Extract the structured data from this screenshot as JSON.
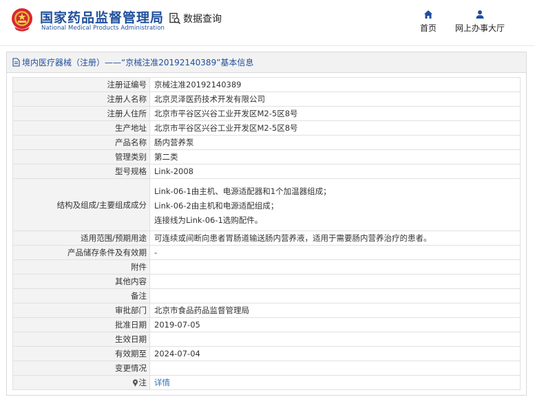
{
  "header": {
    "brand_cn": "国家药品监督管理局",
    "brand_en": "National Medical Products Administration",
    "data_query": "数据查询",
    "nav": [
      {
        "label": "首页",
        "icon": "home-icon"
      },
      {
        "label": "网上办事大厅",
        "icon": "user-icon"
      }
    ]
  },
  "panel": {
    "title": "境内医疗器械（注册）——“京械注准20192140389”基本信息",
    "title_icon": "document-icon"
  },
  "rows": [
    {
      "key": "注册证编号",
      "value": "京械注准20192140389"
    },
    {
      "key": "注册人名称",
      "value": "北京灵泽医药技术开发有限公司"
    },
    {
      "key": "注册人住所",
      "value": "北京市平谷区兴谷工业开发区M2-5区8号"
    },
    {
      "key": "生产地址",
      "value": "北京市平谷区兴谷工业开发区M2-5区8号"
    },
    {
      "key": "产品名称",
      "value": "肠内营养泵"
    },
    {
      "key": "管理类别",
      "value": "第二类"
    },
    {
      "key": "型号规格",
      "value": "Link-2008"
    }
  ],
  "structure": {
    "key": "结构及组成/主要组成成分",
    "lines": [
      "Link-06-1由主机、电源适配器和1个加温器组成；",
      "Link-06-2由主机和电源适配组成；",
      "连接线为Link-06-1选购配件。"
    ]
  },
  "rows2": [
    {
      "key": "适用范围/预期用途",
      "value": "可连续或间断向患者胃肠道输送肠内营养液，适用于需要肠内营养治疗的患者。"
    },
    {
      "key": "产品储存条件及有效期",
      "value": "-"
    },
    {
      "key": "附件",
      "value": ""
    },
    {
      "key": "其他内容",
      "value": ""
    },
    {
      "key": "备注",
      "value": ""
    },
    {
      "key": "审批部门",
      "value": "北京市食品药品监督管理局"
    },
    {
      "key": "批准日期",
      "value": "2019-07-05"
    },
    {
      "key": "生效日期",
      "value": ""
    },
    {
      "key": "有效期至",
      "value": "2024-07-04"
    },
    {
      "key": "变更情况",
      "value": ""
    }
  ],
  "note_row": {
    "key": "注",
    "icon": "info-pin-icon",
    "link": "详情"
  },
  "colors": {
    "brand": "#1f4f9c",
    "link": "#2e72c0",
    "key_bg": "#f3f3f3",
    "border": "#e0e0e0"
  }
}
